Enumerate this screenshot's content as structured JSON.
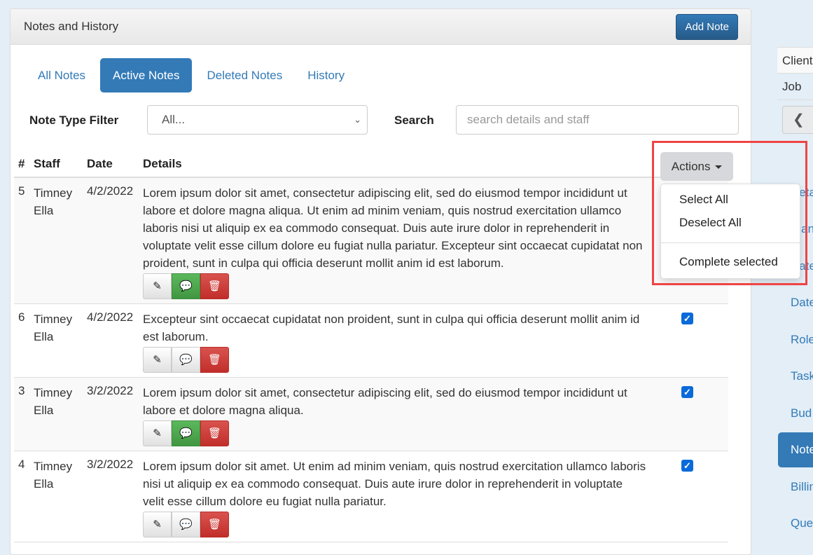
{
  "panel": {
    "title": "Notes and History",
    "add_note_label": "Add Note"
  },
  "tabs": [
    {
      "label": "All Notes",
      "active": false
    },
    {
      "label": "Active Notes",
      "active": true
    },
    {
      "label": "Deleted Notes",
      "active": false
    },
    {
      "label": "History",
      "active": false
    }
  ],
  "filter": {
    "label": "Note Type Filter",
    "selected": "All...",
    "search_label": "Search",
    "search_placeholder": "search details and staff",
    "search_value": ""
  },
  "table": {
    "headers": {
      "num": "#",
      "staff": "Staff",
      "date": "Date",
      "details": "Details"
    },
    "rows": [
      {
        "num": "5",
        "staff": "Timney Ella",
        "date": "4/2/2022",
        "details": "Lorem ipsum dolor sit amet, consectetur adipiscing elit, sed do eiusmod tempor incididunt ut labore et dolore magna aliqua. Ut enim ad minim veniam, quis nostrud exercitation ullamco laboris nisi ut aliquip ex ea commodo consequat. Duis aute irure dolor in reprehenderit in voluptate velit esse cillum dolore eu fugiat nulla pariatur. Excepteur sint occaecat cupidatat non proident, sunt in culpa qui officia deserunt mollit anim id est laborum.",
        "has_comments": true,
        "checked": null
      },
      {
        "num": "6",
        "staff": "Timney Ella",
        "date": "4/2/2022",
        "details": "Excepteur sint occaecat cupidatat non proident, sunt in culpa qui officia deserunt mollit anim id est laborum.",
        "has_comments": false,
        "checked": true
      },
      {
        "num": "3",
        "staff": "Timney Ella",
        "date": "3/2/2022",
        "details": "Lorem ipsum dolor sit amet, consectetur adipiscing elit, sed do eiusmod tempor incididunt ut labore et dolore magna aliqua.",
        "has_comments": true,
        "checked": true
      },
      {
        "num": "4",
        "staff": "Timney Ella",
        "date": "3/2/2022",
        "details": "Lorem ipsum dolor sit amet. Ut enim ad minim veniam, quis nostrud exercitation ullamco laboris nisi ut aliquip ex ea commodo consequat. Duis aute irure dolor in reprehenderit in voluptate velit esse cillum dolore eu fugiat nulla pariatur.",
        "has_comments": false,
        "checked": true
      }
    ]
  },
  "actions": {
    "label": "Actions",
    "menu": [
      "Select All",
      "Deselect All",
      "Complete selected"
    ]
  },
  "sidebar": {
    "info_rows": [
      "Client",
      "Job"
    ],
    "back_icon": "chevron-left-icon",
    "nav_items": [
      "Deta",
      "Plan",
      "Date",
      "Date",
      "Role",
      "Task",
      "Bud",
      "Note",
      "Billin",
      "Que"
    ],
    "active_item": "Note"
  },
  "colors": {
    "primary": "#337ab7",
    "success": "#5cb85c",
    "danger": "#d9534f",
    "checkbox": "#0b6ad9",
    "highlight": "#ef4444"
  }
}
